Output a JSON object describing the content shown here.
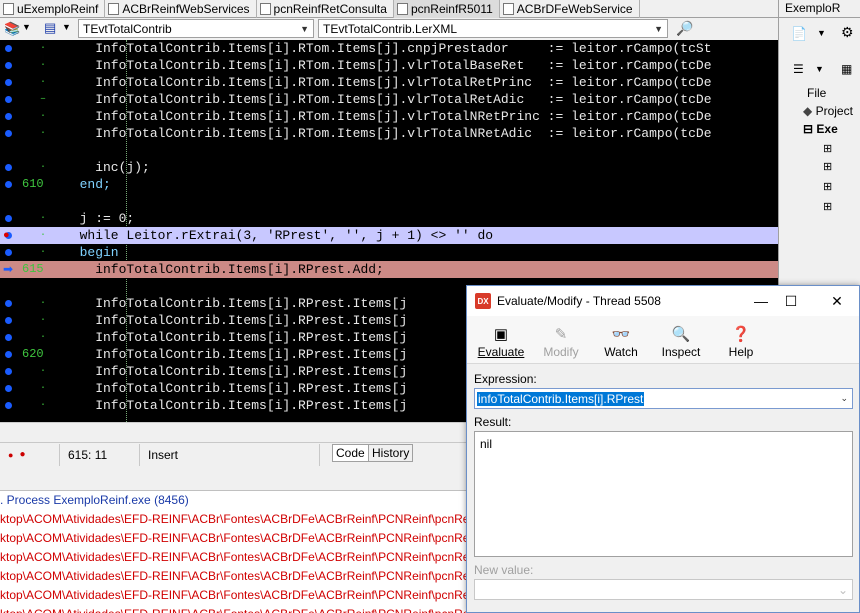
{
  "tabs": [
    {
      "label": "uExemploReinf"
    },
    {
      "label": "ACBrReinfWebServices"
    },
    {
      "label": "pcnReinfRetConsulta"
    },
    {
      "label": "pcnReinfR5011"
    },
    {
      "label": "ACBrDFeWebService"
    }
  ],
  "right_tab": "ExemploR",
  "combos": {
    "class_combo": "TEvtTotalContrib",
    "method_combo": "TEvtTotalContrib.LerXML"
  },
  "editor": {
    "lines": [
      {
        "num": "",
        "code": "    InfoTotalContrib.Items[i].RTom.Items[j].cnpjPrestador     := leitor.rCampo(tcSt"
      },
      {
        "num": "",
        "code": "    InfoTotalContrib.Items[i].RTom.Items[j].vlrTotalBaseRet   := leitor.rCampo(tcDe"
      },
      {
        "num": "",
        "code": "    InfoTotalContrib.Items[i].RTom.Items[j].vlrTotalRetPrinc  := leitor.rCampo(tcDe"
      },
      {
        "num": "",
        "code": "    InfoTotalContrib.Items[i].RTom.Items[j].vlrTotalRetAdic   := leitor.rCampo(tcDe"
      },
      {
        "num": "",
        "code": "    InfoTotalContrib.Items[i].RTom.Items[j].vlrTotalNRetPrinc := leitor.rCampo(tcDe"
      },
      {
        "num": "",
        "code": "    InfoTotalContrib.Items[i].RTom.Items[j].vlrTotalNRetAdic  := leitor.rCampo(tcDe"
      },
      {
        "num": "",
        "code": ""
      },
      {
        "num": "",
        "code": "    inc(j);"
      },
      {
        "num": "610",
        "code": "  end;"
      },
      {
        "num": "",
        "code": ""
      },
      {
        "num": "",
        "code": "  j := 0;"
      },
      {
        "num": "",
        "code": "  while Leitor.rExtrai(3, 'RPrest', '', j + 1) <> '' do"
      },
      {
        "num": "",
        "code": "  begin"
      },
      {
        "num": "615",
        "code": "    infoTotalContrib.Items[i].RPrest.Add;"
      },
      {
        "num": "",
        "code": ""
      },
      {
        "num": "",
        "code": "    InfoTotalContrib.Items[i].RPrest.Items[j"
      },
      {
        "num": "",
        "code": "    InfoTotalContrib.Items[i].RPrest.Items[j"
      },
      {
        "num": "",
        "code": "    InfoTotalContrib.Items[i].RPrest.Items[j"
      },
      {
        "num": "620",
        "code": "    InfoTotalContrib.Items[i].RPrest.Items[j"
      },
      {
        "num": "",
        "code": "    InfoTotalContrib.Items[i].RPrest.Items[j"
      },
      {
        "num": "",
        "code": "    InfoTotalContrib.Items[i].RPrest.Items[j"
      },
      {
        "num": "",
        "code": "    InfoTotalContrib.Items[i].RPrest.Items[j"
      }
    ]
  },
  "status": {
    "position": "615:  11",
    "mode": "Insert",
    "tab_code": "Code",
    "tab_history": "History"
  },
  "messages": [
    ". Process ExemploReinf.exe (8456)",
    "ktop\\ACOM\\Atividades\\EFD-REINF\\ACBr\\Fontes\\ACBrDFe\\ACBrReinf\\PCNReinf\\pcnRei",
    "ktop\\ACOM\\Atividades\\EFD-REINF\\ACBr\\Fontes\\ACBrDFe\\ACBrReinf\\PCNReinf\\pcnRei",
    "ktop\\ACOM\\Atividades\\EFD-REINF\\ACBr\\Fontes\\ACBrDFe\\ACBrReinf\\PCNReinf\\pcnRei",
    "ktop\\ACOM\\Atividades\\EFD-REINF\\ACBr\\Fontes\\ACBrDFe\\ACBrReinf\\PCNReinf\\pcnRei",
    "ktop\\ACOM\\Atividades\\EFD-REINF\\ACBr\\Fontes\\ACBrDFe\\ACBrReinf\\PCNReinf\\pcnRei",
    "ktop\\ACOM\\Atividades\\EFD-REINF\\ACBr\\Fontes\\ACBrDFe\\ACBrReinf\\PCNReinf\\pcnRei"
  ],
  "right_panel": {
    "file_label": "File",
    "tree": [
      "Project",
      "Exe"
    ]
  },
  "dialog": {
    "title": "Evaluate/Modify - Thread 5508",
    "toolbar": {
      "evaluate": "Evaluate",
      "modify": "Modify",
      "watch": "Watch",
      "inspect": "Inspect",
      "help": "Help"
    },
    "expression_label": "Expression:",
    "expression_value": "infoTotalContrib.Items[i].RPrest",
    "result_label": "Result:",
    "result_value": "nil",
    "new_value_label": "New value:",
    "new_value": ""
  },
  "colors": {
    "editor_bg": "#000000",
    "line_numbers": "#3ec43e",
    "exec_line": "#c8c8ff",
    "breakpoint_line": "#cc8a86",
    "error_text": "#d00000",
    "selection": "#0078d7"
  }
}
